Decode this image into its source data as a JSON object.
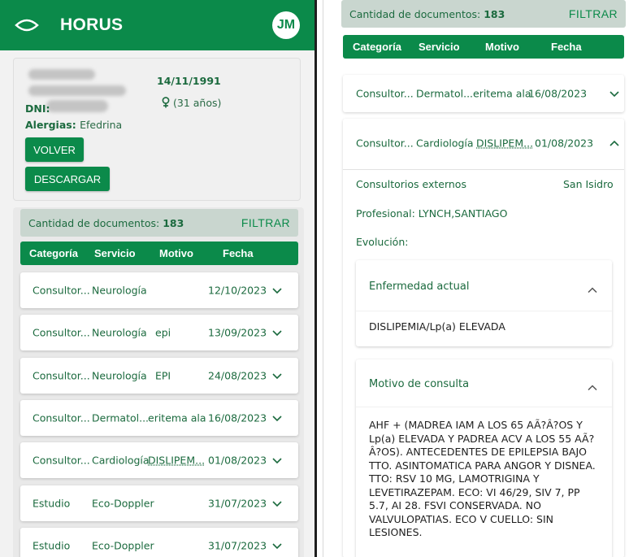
{
  "app": {
    "title": "HORUS",
    "avatar_initials": "JM",
    "brand_color": "#0b8a4a"
  },
  "patient": {
    "birth_date": "14/11/1991",
    "age": "(31 años)",
    "dni_label": "DNI:",
    "allergies_label": "Alergias:",
    "allergies_value": "Efedrina",
    "back_button": "VOLVER",
    "download_button": "DESCARGAR"
  },
  "documents": {
    "count_label": "Cantidad de documentos:",
    "count_value": "183",
    "filter_button": "FILTRAR",
    "columns": [
      "Categoría",
      "Servicio",
      "Motivo",
      "Fecha"
    ],
    "rows": [
      {
        "category": "Consultor...",
        "service": "Neurología",
        "reason": "",
        "date": "12/10/2023"
      },
      {
        "category": "Consultor...",
        "service": "Neurología",
        "reason": "epi",
        "date": "13/09/2023"
      },
      {
        "category": "Consultor...",
        "service": "Neurología",
        "reason": "EPI",
        "date": "24/08/2023"
      },
      {
        "category": "Consultor...",
        "service": "Dermatol...",
        "reason": "eritema ala",
        "date": "16/08/2023"
      },
      {
        "category": "Consultor...",
        "service": "Cardiología",
        "reason": "DISLIPEM...",
        "date": "01/08/2023"
      },
      {
        "category": "Estudio",
        "service": "Eco-Doppler",
        "reason": "",
        "date": "31/07/2023"
      },
      {
        "category": "Estudio",
        "service": "Eco-Doppler",
        "reason": "",
        "date": "31/07/2023"
      }
    ]
  },
  "detail": {
    "collapsed_row": {
      "category": "Consultor...",
      "service": "Dermatol...",
      "reason": "eritema ala",
      "date": "16/08/2023"
    },
    "expanded_row": {
      "category": "Consultor...",
      "service": "Cardiología",
      "reason": "DISLIPEM...",
      "date": "01/08/2023"
    },
    "site": "Consultorios externos",
    "location": "San Isidro",
    "professional": "Profesional: LYNCH,SANTIAGO",
    "evolution_label": "Evolución:",
    "current_illness": {
      "title": "Enfermedad actual",
      "text": "DISLIPEMIA/Lp(a) ELEVADA"
    },
    "consult_reason": {
      "title": "Motivo de consulta",
      "text": "AHF + (MADREA IAM A LOS 65 AÃ?Â?OS Y Lp(a) ELEVADA Y PADREA ACV A LOS 55 AÃ?Â?OS). ANTECEDENTES DE EPILEPSIA BAJO TTO. ASINTOMATICA PARA ANGOR Y DISNEA. TTO: RSV 10 MG, LAMOTRIGINA Y LEVETIRAZEPAM. ECO: VI 46/29, SIV 7, PP 5.7, AI 28. FSVI CONSERVADA. NO VALVULOPATIAS. ECO V CUELLO: SIN LESIONES."
    }
  }
}
